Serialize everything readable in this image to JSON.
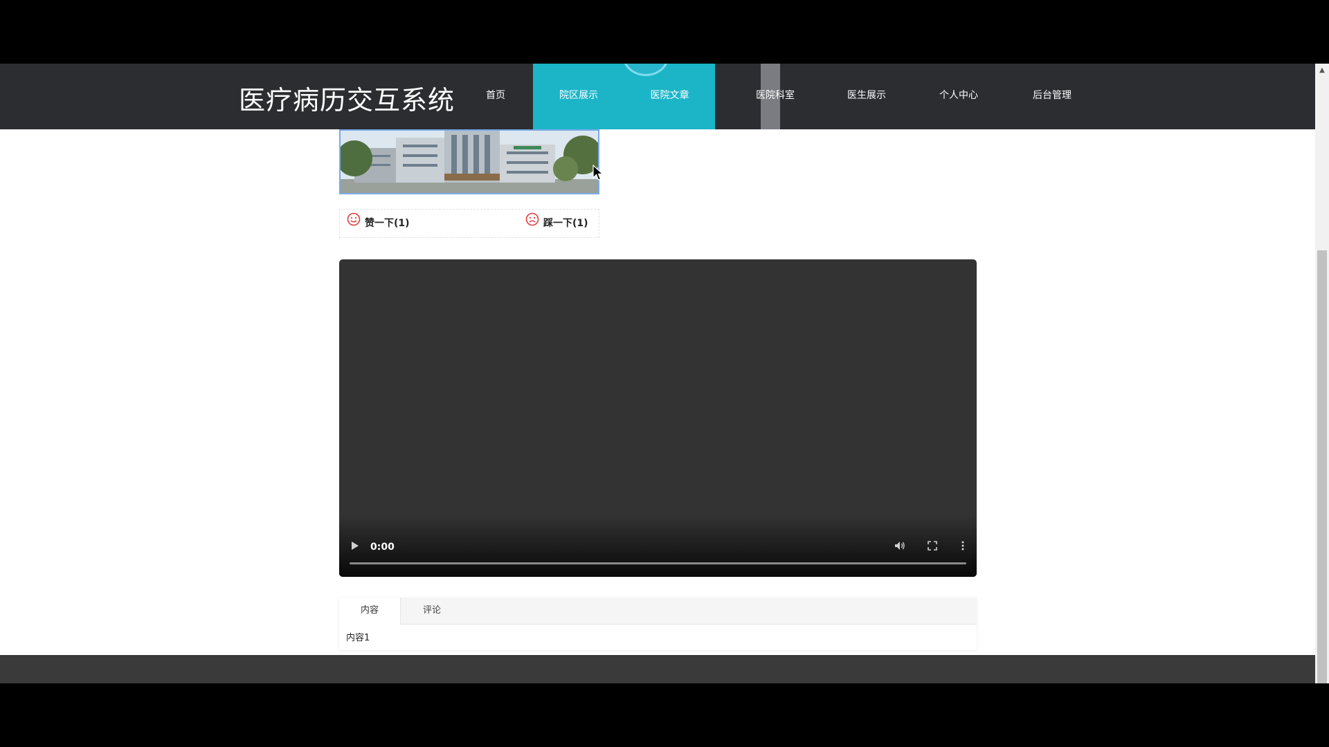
{
  "header": {
    "site_title": "医疗病历交互系统",
    "nav": [
      {
        "label": "首页"
      },
      {
        "label": "院区展示"
      },
      {
        "label": "医院文章"
      },
      {
        "label": "医院科室"
      },
      {
        "label": "医生展示"
      },
      {
        "label": "个人中心"
      },
      {
        "label": "后台管理"
      }
    ],
    "active_index": 1
  },
  "votes": {
    "like_label": "赞一下(1)",
    "dislike_label": "踩一下(1)"
  },
  "video": {
    "time": "0:00",
    "progress": 0
  },
  "tabs": {
    "items": [
      {
        "label": "内容"
      },
      {
        "label": "评论"
      }
    ],
    "active_index": 0,
    "content": "内容1"
  },
  "colors": {
    "header_bg": "#2b2d31",
    "accent": "#1cb5c8",
    "vote_icon": "#e03c3c"
  }
}
